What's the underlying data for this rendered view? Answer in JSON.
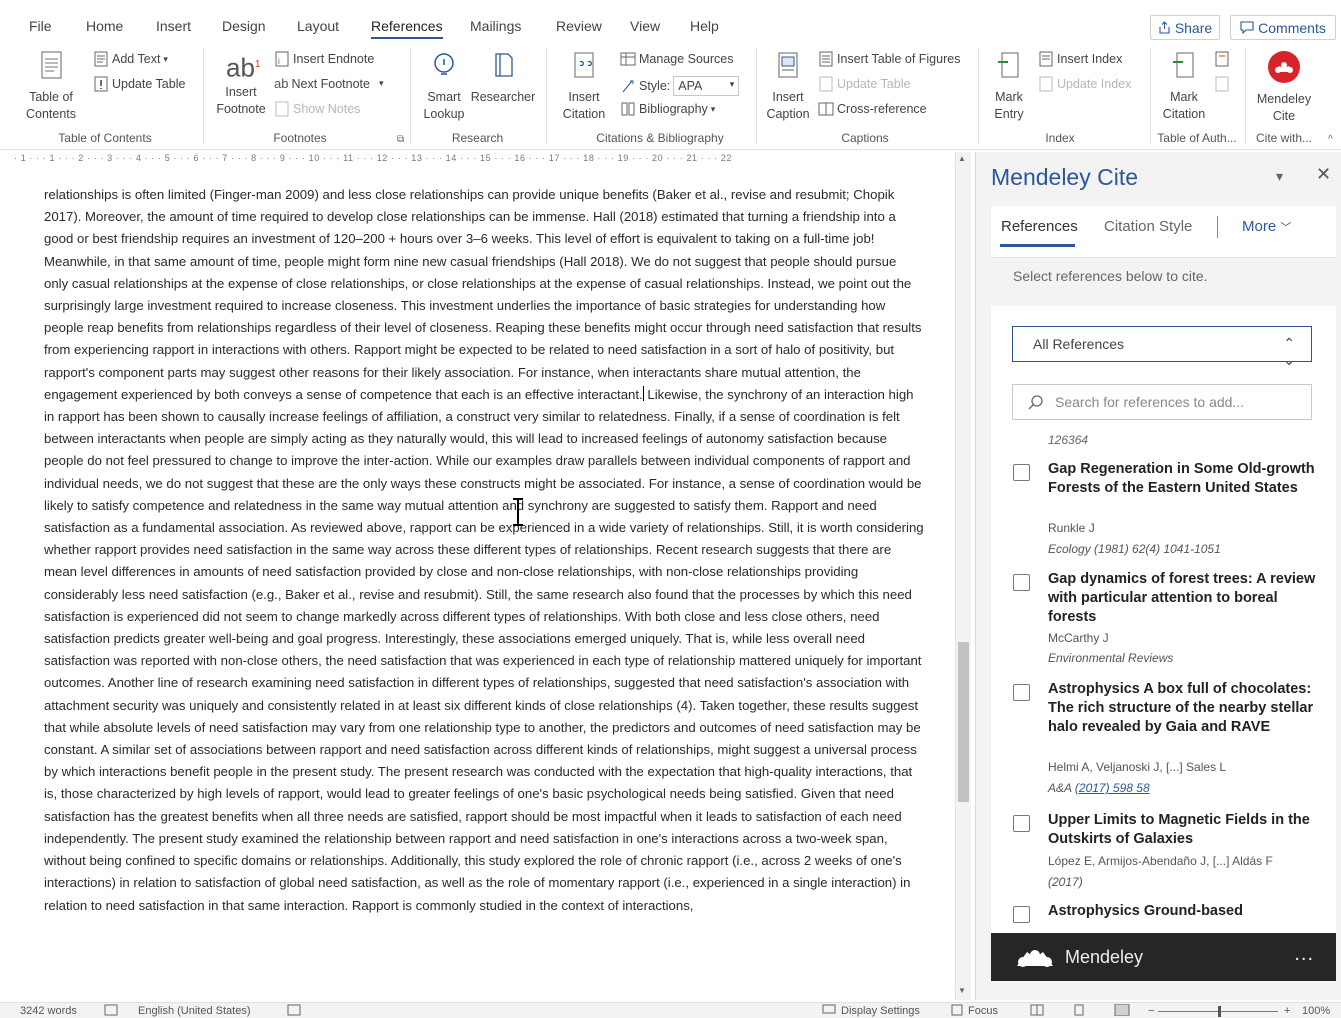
{
  "menu": {
    "tabs": [
      "File",
      "Home",
      "Insert",
      "Design",
      "Layout",
      "References",
      "Mailings",
      "Review",
      "View",
      "Help"
    ],
    "active_tab": "References",
    "share_label": "Share",
    "comments_label": "Comments"
  },
  "ribbon": {
    "toc": {
      "table_of_contents": "Table of\nContents",
      "add_text": "Add Text",
      "update_table": "Update Table",
      "group": "Table of Contents"
    },
    "footnotes": {
      "insert_footnote": "Insert\nFootnote",
      "insert_endnote": "Insert Endnote",
      "next_footnote": "Next Footnote",
      "show_notes": "Show Notes",
      "group": "Footnotes"
    },
    "research": {
      "smart_lookup": "Smart\nLookup",
      "researcher": "Researcher",
      "group": "Research"
    },
    "citations": {
      "insert_citation": "Insert\nCitation",
      "manage_sources": "Manage Sources",
      "style_label": "Style:",
      "style_value": "APA",
      "bibliography": "Bibliography",
      "group": "Citations & Bibliography"
    },
    "captions": {
      "insert_caption": "Insert\nCaption",
      "insert_table_of_figures": "Insert Table of Figures",
      "update_table": "Update Table",
      "cross_reference": "Cross-reference",
      "group": "Captions"
    },
    "index": {
      "mark_entry": "Mark\nEntry",
      "insert_index": "Insert Index",
      "update_index": "Update Index",
      "group": "Index"
    },
    "toa": {
      "mark_citation": "Mark\nCitation",
      "group": "Table of Auth..."
    },
    "mendeley": {
      "mendeley_cite": "Mendeley\nCite",
      "group": "Cite with..."
    }
  },
  "ruler": {
    "scale": "· 1 · · · 1 · · · 2 · · · 3 · · · 4 · · · 5 · · · 6 · · · 7 · · · 8 · · · 9 · · · 10 · · · 11 · · · 12 · · · 13 · · · 14 · · · 15 · · · 16 · · · 17 · · · 18 · · · 19 · · · 20 · · · 21 · · · 22"
  },
  "document": {
    "text_before_cursor": "relationships is often limited (Finger-man 2009) and less close relationships can provide unique benefits (Baker et al., revise and resubmit; Chopik 2017). Moreover, the amount of time required to develop close relationships can be immense. Hall (2018) estimated that turning a friendship into a good or best friendship requires an investment of 120–200 + hours over 3–6 weeks. This level of effort is equivalent to taking on a full-time job! Meanwhile, in that same amount of time, people might form nine new casual friendships (Hall 2018). We do not suggest that people should pursue only casual relationships at the expense of close relationships, or close relationships at the expense of casual relationships. Instead, we point out the surprisingly large investment required to increase closeness. This investment underlies the importance of basic strategies for understanding how people reap benefits from relationships regardless of their level of closeness. Reaping these benefits might occur through need satisfaction that results from experiencing rapport in interactions with others. Rapport might be expected to be related to need satisfaction in a sort of halo of positivity, but rapport's component parts may suggest other reasons for their likely association. For instance, when interactants share mutual attention, the engagement experienced by both conveys a sense of competence that each is an effective interactant.",
    "text_after_cursor": " Likewise, the synchrony of an interaction high in rapport has been shown to causally increase feelings of affiliation, a construct very similar to relatedness. Finally, if a sense of coordination is felt between interactants when people are simply acting as they naturally would, this will lead to increased feelings of autonomy satisfaction because people do not feel pressured to change to improve the inter-action. While our examples draw parallels between individual components of rapport and individual needs, we do not suggest that these are the only ways these constructs might be associated. For instance, a sense of coordination would be likely to satisfy competence and relatedness in the same way mutual attention and synchrony are suggested to satisfy them. Rapport and need satisfaction as a fundamental association. As reviewed above, rapport can be experienced in a wide variety of relationships. Still, it is worth considering whether rapport provides need satisfaction in the same way across these different types of relationships. Recent research suggests that there are mean level differences in amounts of need satisfaction provided by close and non-close relationships, with non-close relationships providing considerably less need satisfaction (e.g., Baker et al., revise and resubmit). Still, the same research also found that the processes by which this need satisfaction is experienced did not seem to change markedly across different types of relationships. With both close and less close others, need satisfaction predicts greater well-being and goal progress. Interestingly, these associations emerged uniquely. That is, while less overall need satisfaction was reported with non-close others, the need satisfaction that was experienced in each type of relationship mattered uniquely for important outcomes. Another line of research examining need satisfaction in different types of relationships, suggested that need satisfaction's association with attachment security was uniquely and consistently related in at least six different kinds of close relationships (4). Taken together, these results suggest that while absolute levels of need satisfaction may vary from one relationship type to another, the predictors and outcomes of need satisfaction may be constant. A similar set of associations between rapport and need satisfaction across different kinds of relationships, might suggest a universal process by which interactions benefit people in the present study. The present research was conducted with the expectation that high-quality interactions, that is, those characterized by high levels of rapport, would lead to greater feelings of one's basic psychological needs being satisfied. Given that need satisfaction has the greatest benefits when all three needs are satisfied, rapport should be most impactful when it leads to satisfaction of each need independently. The present study examined the relationship between rapport and need satisfaction in one's interactions across a two-week span, without being confined to specific domains or relationships. Additionally, this study explored the role of chronic rapport (i.e., across 2 weeks of one's interactions) in relation to satisfaction of global need satisfaction, as well as the role of momentary rapport (i.e., experienced in a single interaction) in relation to need satisfaction in that same interaction. Rapport is commonly studied in the context of interactions,"
  },
  "pane": {
    "title": "Mendeley Cite",
    "tabs": {
      "references": "References",
      "citation_style": "Citation Style",
      "more": "More"
    },
    "hint": "Select references below to cite.",
    "filter": "All References",
    "search_placeholder": "Search for references to add...",
    "stub_text": "126364",
    "items": [
      {
        "title": "Gap Regeneration in Some Old-growth Forests of the Eastern United States",
        "authors": "Runkle J",
        "journal": "Ecology (1981) 62(4) 1041-1051",
        "link": ""
      },
      {
        "title": "Gap dynamics of forest trees: A review with particular attention to boreal forests",
        "authors": "McCarthy J",
        "journal": "Environmental Reviews",
        "link": ""
      },
      {
        "title": "Astrophysics A box full of chocolates: The rich structure of the nearby stellar halo revealed by Gaia and RAVE",
        "authors": "Helmi A, Veljanoski J, [...] Sales L",
        "journal": "A&A ",
        "link": "(2017) 598 58"
      },
      {
        "title": "Upper Limits to Magnetic Fields in the Outskirts of Galaxies",
        "authors": "López E, Armijos-Abendaño J, [...] Aldás F",
        "journal": "(2017)",
        "link": ""
      },
      {
        "title": "Astrophysics Ground-based",
        "authors": "",
        "journal": "",
        "link": ""
      }
    ],
    "footer_label": "Mendeley",
    "footer_more": "..."
  },
  "status": {
    "words": "3242 words",
    "language": "English (United States)",
    "display_settings": "Display Settings",
    "focus": "Focus",
    "zoom": "100%"
  },
  "colors": {
    "accent": "#2b579a",
    "mendeley_red": "#d8232a",
    "footer_bg": "#262626"
  }
}
